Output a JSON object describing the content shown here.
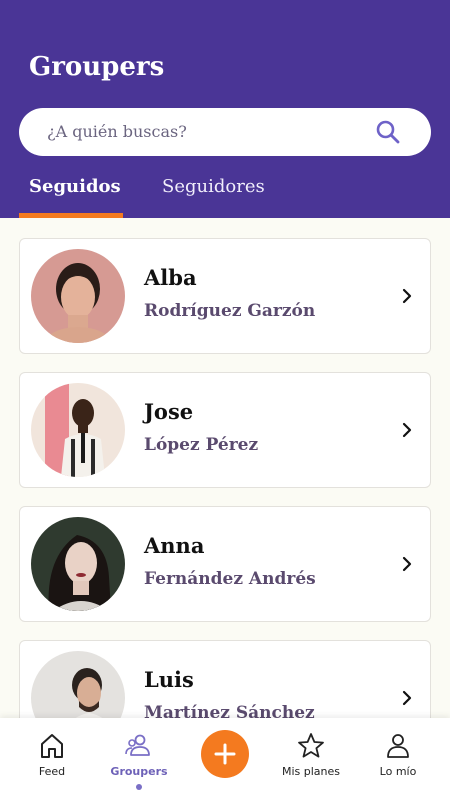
{
  "header": {
    "title": "Groupers",
    "search_placeholder": "¿A quién buscas?",
    "tabs": [
      {
        "label": "Seguidos",
        "active": true
      },
      {
        "label": "Seguidores",
        "active": false
      }
    ]
  },
  "people": [
    {
      "first": "Alba",
      "last": "Rodríguez Garzón"
    },
    {
      "first": "Jose",
      "last": "López Pérez"
    },
    {
      "first": "Anna",
      "last": "Fernández Andrés"
    },
    {
      "first": "Luis",
      "last": "Martínez Sánchez"
    }
  ],
  "bottom_nav": {
    "items": [
      {
        "label": "Feed",
        "icon": "home-icon"
      },
      {
        "label": "Groupers",
        "icon": "people-icon",
        "active": true
      },
      {
        "label": "",
        "icon": "plus-icon"
      },
      {
        "label": "Mis planes",
        "icon": "star-icon"
      },
      {
        "label": "Lo mío",
        "icon": "user-icon"
      }
    ]
  },
  "colors": {
    "header": "#4a3596",
    "accent": "#f47a1f",
    "active_nav": "#6e62b8",
    "surname": "#5a4a6e"
  }
}
